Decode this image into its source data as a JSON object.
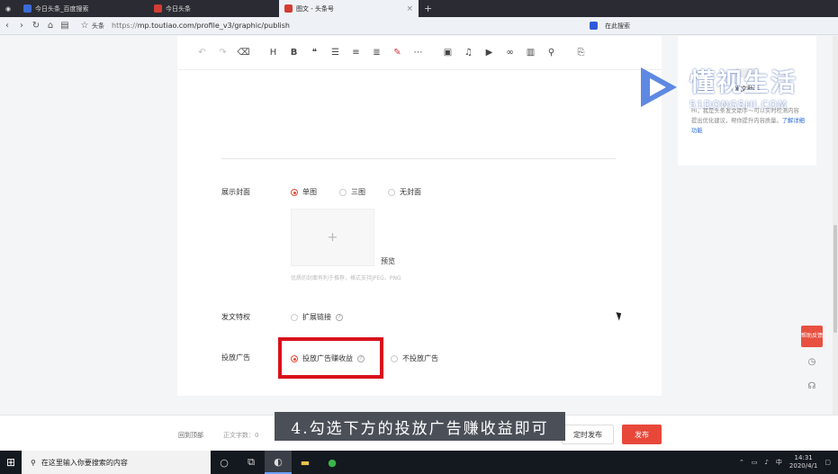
{
  "browser": {
    "tabs": [
      {
        "label": "今日头条_百度搜索",
        "active": false
      },
      {
        "label": "今日头条",
        "active": false
      },
      {
        "label": "图文 - 头条号",
        "active": true
      }
    ],
    "bookmark_label": "头条",
    "url_protocol": "https://",
    "url_rest": "mp.toutiao.com/profile_v3/graphic/publish",
    "search_hint": "在此搜索"
  },
  "editor": {
    "toolbar_icons": [
      "undo-icon",
      "redo-icon",
      "eraser-icon",
      "heading-icon",
      "bold-icon",
      "quote-icon",
      "unordered-list-icon",
      "ordered-list-icon",
      "align-icon",
      "highlight-icon",
      "more-icon",
      "image-icon",
      "audio-icon",
      "video-icon",
      "link-icon",
      "chart-icon",
      "attachment-icon",
      "template-icon"
    ],
    "toolbar_glyphs": {
      "heading": "H",
      "bold": "B",
      "quote": "❝",
      "more": "⋯"
    }
  },
  "settings": {
    "cover_label": "展示封面",
    "cover_options": [
      {
        "label": "单图",
        "selected": true
      },
      {
        "label": "三图",
        "selected": false
      },
      {
        "label": "无封面",
        "selected": false
      }
    ],
    "cover_add": "+",
    "preview_label": "预览",
    "cover_hint": "优质的封面有利于推荐，格式支持JPEG、PNG",
    "privilege_label": "发文特权",
    "privilege_option": "扩展链接",
    "ad_label": "投放广告",
    "ad_options": [
      {
        "label": "投放广告赚收益",
        "selected": true
      },
      {
        "label": "不投放广告",
        "selected": false
      }
    ]
  },
  "helper": {
    "name": "发文助手",
    "text": "Hi，我是头条发文助手～可以实时检测内容提出优化建议，帮你提升内容质量。",
    "link": "了解详细功能"
  },
  "float_buttons": {
    "feedback": "帮助反馈"
  },
  "watermark": {
    "title": "懂视生活",
    "subtitle": "51DONGSHI.COM"
  },
  "bottom": {
    "back_top": "回到顶部",
    "word_count": "正文字数：0",
    "schedule_btn": "定时发布",
    "publish_btn": "发布"
  },
  "caption": "4.勾选下方的投放广告赚收益即可",
  "taskbar": {
    "search_placeholder": "在这里输入你要搜索的内容",
    "time": "14:31",
    "date": "2020/4/1",
    "ime": "中"
  }
}
